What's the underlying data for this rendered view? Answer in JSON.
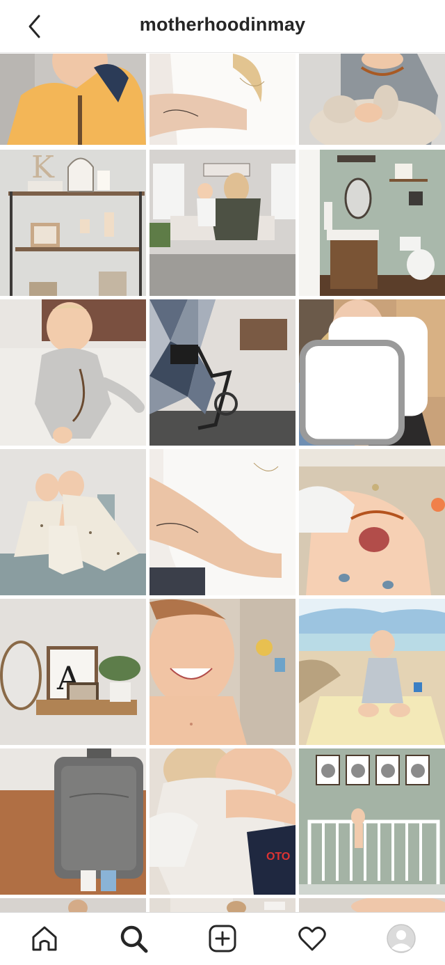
{
  "header": {
    "title": "motherhoodinmay",
    "back_icon": "chevron-left-icon"
  },
  "grid": {
    "tiles": [
      {
        "subject": "boy-yellow-jacket"
      },
      {
        "subject": "arm-tattoo-necklace"
      },
      {
        "subject": "toddler-amber-necklace-plush"
      },
      {
        "subject": "shelf-decor-letter-k"
      },
      {
        "subject": "mirror-selfie-with-baby"
      },
      {
        "subject": "sage-bathroom"
      },
      {
        "subject": "baby-gray-romper"
      },
      {
        "subject": "peloton-accent-wall"
      },
      {
        "subject": "selfie-face-mask",
        "badge": "multiple-photos-icon"
      },
      {
        "subject": "three-kids-matching-pajamas"
      },
      {
        "subject": "arm-tattoo-white-tee"
      },
      {
        "subject": "baby-upside-down-smile"
      },
      {
        "subject": "letter-a-mirror-shelf"
      },
      {
        "subject": "smiling-boy-closeup"
      },
      {
        "subject": "baby-on-beach"
      },
      {
        "subject": "gray-suitcase"
      },
      {
        "subject": "mother-kissing-baby"
      },
      {
        "subject": "crib-nursery-animal-prints"
      }
    ]
  },
  "tabbar": {
    "items": [
      {
        "name": "home-tab",
        "icon": "home-icon"
      },
      {
        "name": "search-tab",
        "icon": "search-icon",
        "active": true
      },
      {
        "name": "new-post-tab",
        "icon": "plus-square-icon"
      },
      {
        "name": "activity-tab",
        "icon": "heart-icon"
      },
      {
        "name": "profile-tab",
        "icon": "avatar-icon"
      }
    ]
  },
  "colors": {
    "text": "#262626",
    "divider": "#dbdbdb",
    "background": "#ffffff"
  }
}
